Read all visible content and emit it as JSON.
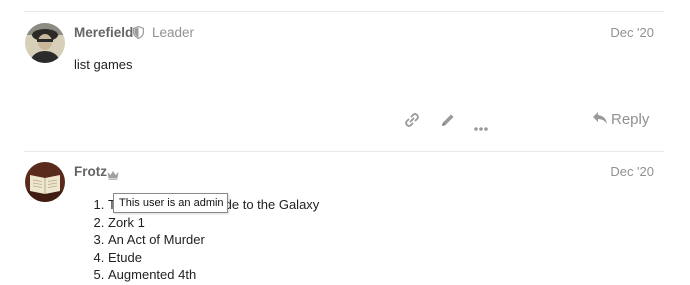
{
  "posts": [
    {
      "username": "Merefield",
      "title": "Leader",
      "date": "Dec '20",
      "content": "list games"
    },
    {
      "username": "Frotz",
      "date": "Dec '20",
      "games": [
        "The Hitchhiker's Guide to the Galaxy",
        "Zork 1",
        "An Act of Murder",
        "Etude",
        "Augmented 4th"
      ]
    }
  ],
  "actions": {
    "reply_label": "Reply",
    "icons": [
      "link-icon",
      "pencil-icon",
      "more-icon",
      "reply-icon"
    ]
  },
  "tooltip": {
    "text": "This user is an admin"
  },
  "icons": {
    "moderator_shield": "shield-icon",
    "admin_crown": "crown-icon"
  },
  "colors": {
    "muted": "#919191",
    "username": "#646464",
    "divider": "#e9e9e9"
  }
}
